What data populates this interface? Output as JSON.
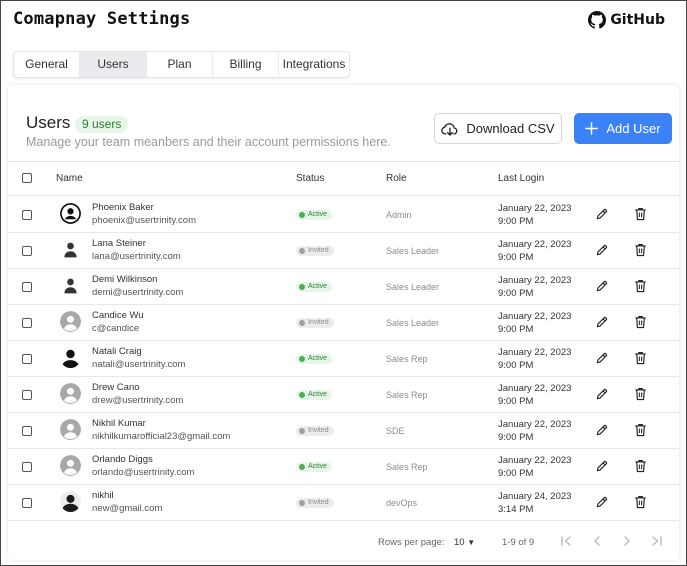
{
  "app": {
    "title": "Comapnay Settings",
    "github_label": "GitHub"
  },
  "tabs": [
    {
      "label": "General",
      "active": false
    },
    {
      "label": "Users",
      "active": true
    },
    {
      "label": "Plan",
      "active": false
    },
    {
      "label": "Billing",
      "active": false
    },
    {
      "label": "Integrations",
      "active": false
    }
  ],
  "header": {
    "title": "Users",
    "badge": "9 users",
    "subtitle": "Manage your team meanbers and their account permissions here.",
    "download_label": "Download CSV",
    "add_label": "Add User"
  },
  "table": {
    "columns": {
      "name": "Name",
      "status": "Status",
      "role": "Role",
      "last_login": "Last Login"
    },
    "rows": [
      {
        "name": "Phoenix Baker",
        "email": "phoenix@usertrinity.com",
        "status": "Active",
        "role": "Admin",
        "date": "January 22, 2023",
        "time": "9:00 PM",
        "avatar": "account-circle-icon"
      },
      {
        "name": "Lana Steiner",
        "email": "lana@usertrinity.com",
        "status": "Invited",
        "role": "Sales Leader",
        "date": "January 22, 2023",
        "time": "9:00 PM",
        "avatar": "person-icon"
      },
      {
        "name": "Demi Wilkinson",
        "email": "demi@usertrinity.com",
        "status": "Active",
        "role": "Sales Leader",
        "date": "January 22, 2023",
        "time": "9:00 PM",
        "avatar": "person-icon"
      },
      {
        "name": "Candice Wu",
        "email": "c@candice",
        "status": "Invited",
        "role": "Sales Leader",
        "date": "January 22, 2023",
        "time": "9:00 PM",
        "avatar": "default-avatar-icon"
      },
      {
        "name": "Natali Craig",
        "email": "natali@usertrinity.com",
        "status": "Active",
        "role": "Sales Rep",
        "date": "January 22, 2023",
        "time": "9:00 PM",
        "avatar": "person-silhouette-icon"
      },
      {
        "name": "Drew Cano",
        "email": "drew@usertrinity.com",
        "status": "Active",
        "role": "Sales Rep",
        "date": "January 22, 2023",
        "time": "9:00 PM",
        "avatar": "default-avatar-icon"
      },
      {
        "name": "Nikhil Kumar",
        "email": "nikhilkumarofficial23@gmail.com",
        "status": "Invited",
        "role": "SDE",
        "date": "January 22, 2023",
        "time": "9:00 PM",
        "avatar": "default-avatar-icon"
      },
      {
        "name": "Orlando Diggs",
        "email": "orlando@usertrinity.com",
        "status": "Active",
        "role": "Sales Rep",
        "date": "January 22, 2023",
        "time": "9:00 PM",
        "avatar": "default-avatar-icon"
      },
      {
        "name": "nikhil",
        "email": "new@gmail.com",
        "status": "Invited",
        "role": "devOps",
        "date": "January 24, 2023",
        "time": "3:14 PM",
        "avatar": "person-photo-icon"
      }
    ]
  },
  "pagination": {
    "rows_per_page_label": "Rows per page:",
    "rows_per_page": "10",
    "range": "1-9 of 9"
  },
  "colors": {
    "primary": "#3b82f6",
    "active_bg": "#e6f6e8",
    "active_text": "#2e7d32",
    "invited_bg": "#ececec",
    "invited_text": "#8a8a8a"
  }
}
